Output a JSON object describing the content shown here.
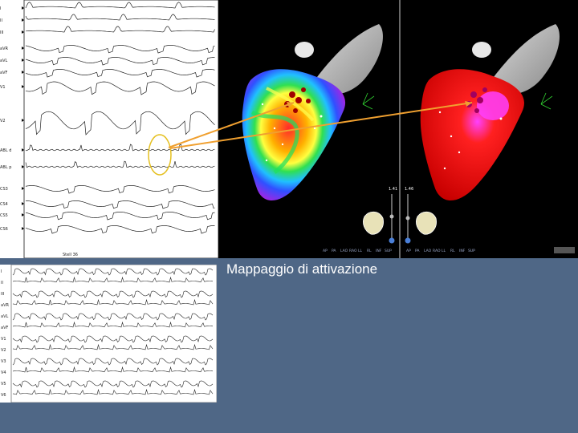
{
  "caption": "Mappaggio di attivazione",
  "ecg_top": {
    "lead_labels": [
      "I",
      "II",
      "III",
      "aVR",
      "aVL",
      "aVF",
      "V1",
      "V2",
      "ABL d",
      "ABL p",
      "CS3",
      "CS4",
      "CS5",
      "CS6"
    ],
    "footer_text": "Stell 36"
  },
  "ecg_bottom": {
    "lead_labels": [
      "I",
      "II",
      "III",
      "aVR",
      "aVL",
      "aVF",
      "V1",
      "V2",
      "V3",
      "V4",
      "V5",
      "V6"
    ]
  },
  "map": {
    "left_range_label": "1.41",
    "right_range_label": "1.46",
    "view_labels": [
      "AP",
      "PA",
      "LAO",
      "RAO",
      "LL",
      "RL",
      "INF",
      "SUP"
    ],
    "colors": {
      "background": "#4f6786",
      "arrow": "#f0a030",
      "highlight_ring": "#e5c020",
      "early_activation": "#e01818",
      "late_activation": "#8a2be2"
    }
  }
}
